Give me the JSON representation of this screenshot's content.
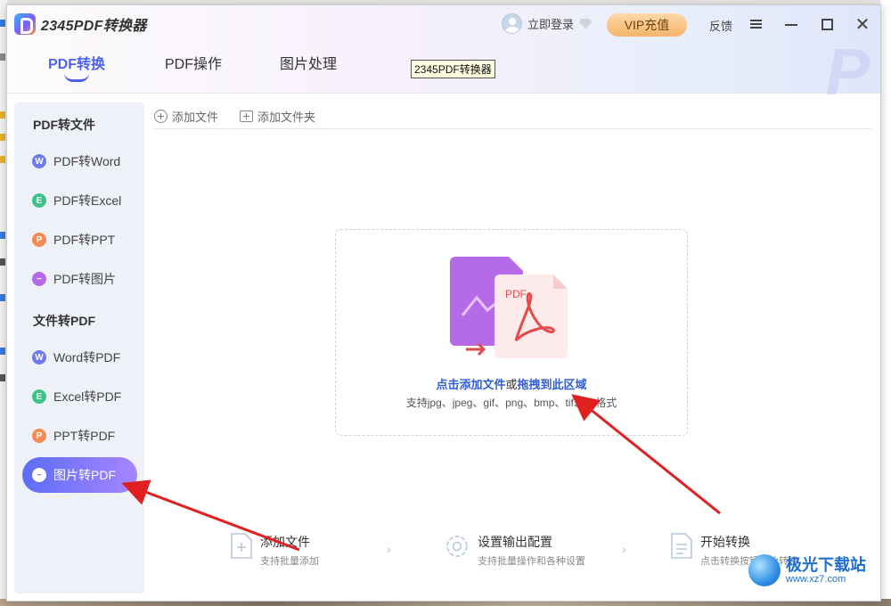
{
  "app": {
    "name": "2345PDF转换器",
    "login_label": "立即登录",
    "vip_label": "VIP充值",
    "feedback_label": "反馈",
    "tooltip": "2345PDF转换器"
  },
  "tabs": [
    {
      "label": "PDF转换",
      "active": true
    },
    {
      "label": "PDF操作",
      "active": false
    },
    {
      "label": "图片处理",
      "active": false
    }
  ],
  "sidebar": {
    "section1": "PDF转文件",
    "section2": "文件转PDF",
    "items": [
      {
        "label": "PDF转Word",
        "icon": "word-icon",
        "icon_char": "W",
        "color": "#6d79f0"
      },
      {
        "label": "PDF转Excel",
        "icon": "excel-icon",
        "icon_char": "E",
        "color": "#3cc38a"
      },
      {
        "label": "PDF转PPT",
        "icon": "ppt-icon",
        "icon_char": "P",
        "color": "#f58a55"
      },
      {
        "label": "PDF转图片",
        "icon": "image-icon",
        "icon_char": "~",
        "color": "#b56ae8"
      },
      {
        "label": "Word转PDF",
        "icon": "word-icon",
        "icon_char": "W",
        "color": "#6d79f0"
      },
      {
        "label": "Excel转PDF",
        "icon": "excel-icon",
        "icon_char": "E",
        "color": "#3cc38a"
      },
      {
        "label": "PPT转PDF",
        "icon": "ppt-icon",
        "icon_char": "P",
        "color": "#f58a55"
      },
      {
        "label": "图片转PDF",
        "icon": "image-icon",
        "icon_char": "~",
        "color": "#ffffff",
        "active": true
      }
    ]
  },
  "toolbar": {
    "add_file": "添加文件",
    "add_folder": "添加文件夹"
  },
  "dropzone": {
    "title_click": "点击添加文件",
    "title_or": "或",
    "title_drag": "拖拽到此区域",
    "subtitle": "支持jpg、jpeg、gif、png、bmp、tif、tiff格式",
    "pdf_badge": "PDF"
  },
  "steps": [
    {
      "title": "添加文件",
      "desc": "支持批量添加",
      "icon": "add-file-icon"
    },
    {
      "title": "设置输出配置",
      "desc": "支持批量操作和各种设置",
      "icon": "settings-icon"
    },
    {
      "title": "开始转换",
      "desc": "点击转换按钮开始转换",
      "icon": "document-icon"
    }
  ],
  "watermark": {
    "name": "极光下载站",
    "url": "www.xz7.com"
  },
  "colors": {
    "accent": "#4d63f0",
    "vip": "#f5b46a",
    "annotation_arrow": "#e02020"
  }
}
